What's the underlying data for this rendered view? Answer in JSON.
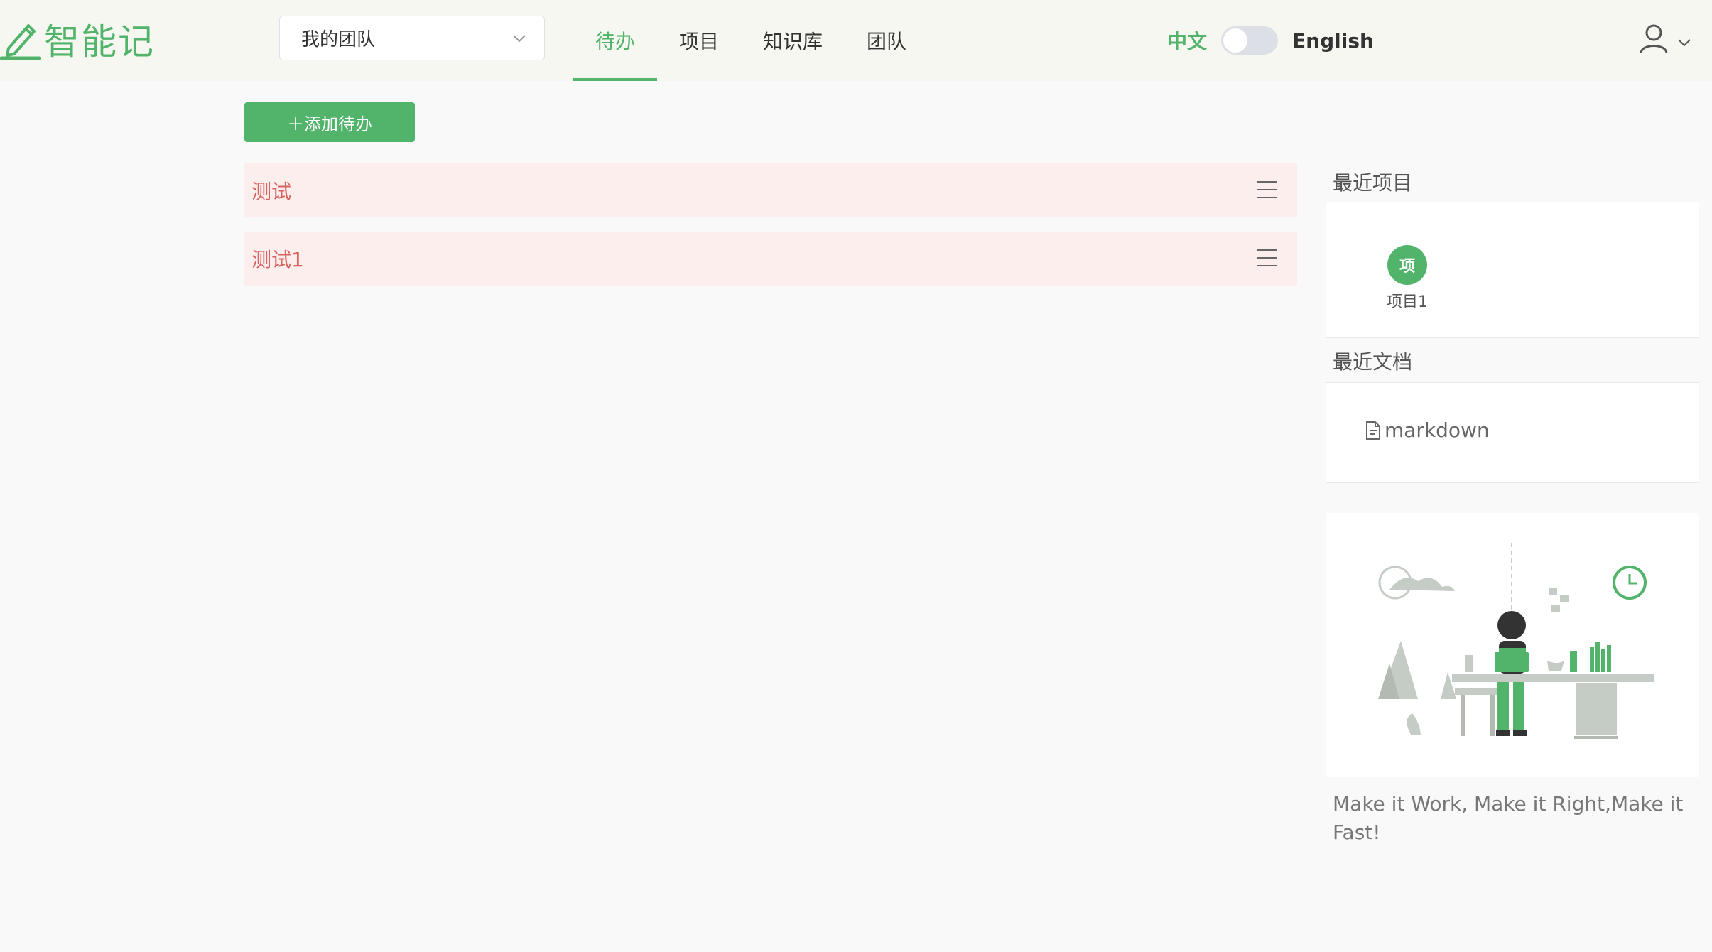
{
  "app": {
    "name": "智能记"
  },
  "team_select": {
    "value": "我的团队"
  },
  "nav": {
    "items": [
      {
        "label": "待办"
      },
      {
        "label": "项目"
      },
      {
        "label": "知识库"
      },
      {
        "label": "团队"
      }
    ]
  },
  "lang": {
    "zh": "中文",
    "en": "English"
  },
  "todo": {
    "add_label": "＋添加待办",
    "items": [
      {
        "title": "测试"
      },
      {
        "title": "测试1"
      }
    ]
  },
  "sidebar": {
    "recent_projects_title": "最近项目",
    "projects": [
      {
        "badge": "项",
        "name": "项目1"
      }
    ],
    "recent_docs_title": "最近文档",
    "docs": [
      {
        "name": "markdown"
      }
    ],
    "motto": "Make it Work, Make it Right,Make it Fast!"
  },
  "colors": {
    "accent": "#52b46b",
    "todo_bg": "#fdeeee",
    "todo_text": "#d9625f",
    "header_bg": "#f6f7f1"
  }
}
